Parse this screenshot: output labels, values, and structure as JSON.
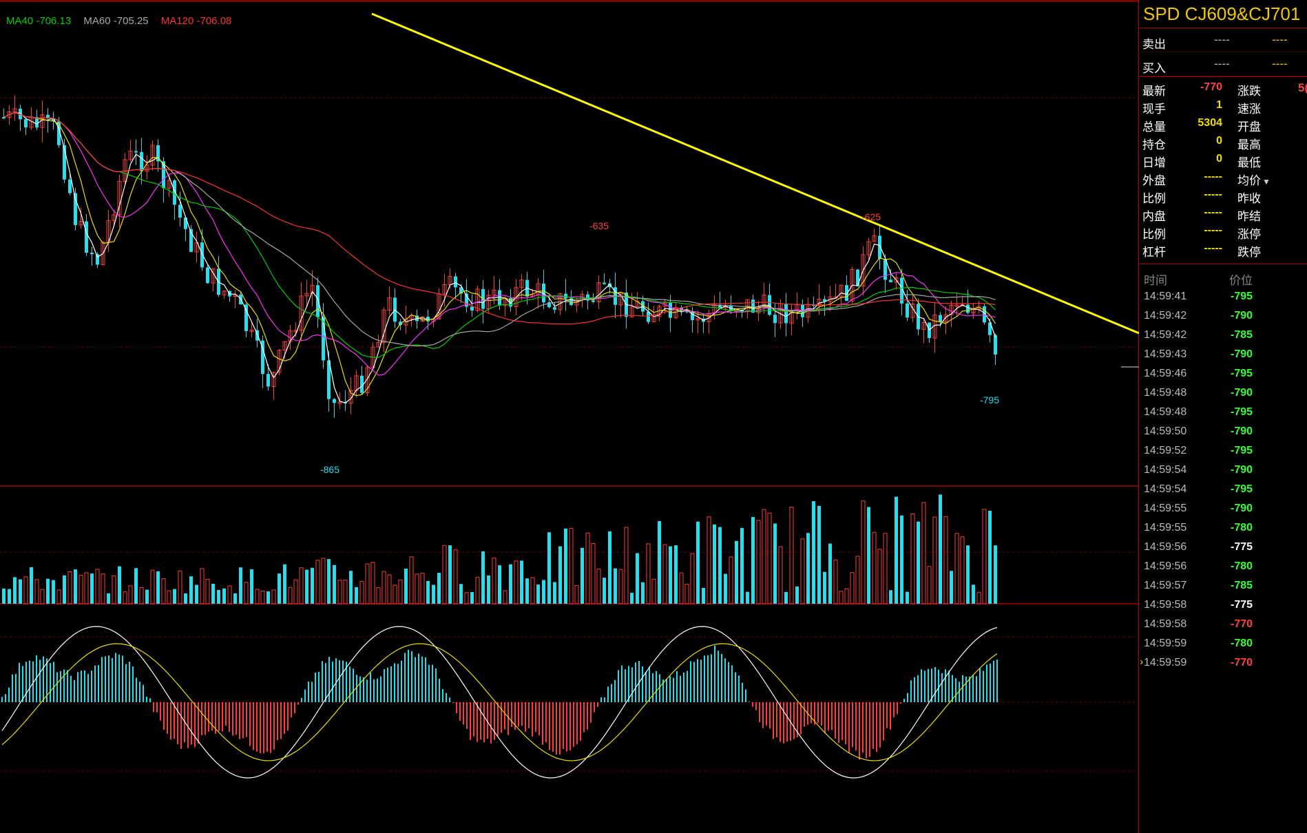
{
  "indicators": [
    {
      "label": "MA40 -706.13",
      "color": "#00d000"
    },
    {
      "label": "MA60 -705.25",
      "color": "#a8a8a8"
    },
    {
      "label": "MA120 -706.08",
      "color": "#ff3030"
    }
  ],
  "price_annotations": {
    "high_1": "-635",
    "high_2": "-625",
    "low_1": "-865",
    "last": "-795"
  },
  "quote_panel": {
    "title": "SPD CJ609&CJ701",
    "order_book": [
      {
        "label": "卖出",
        "v1": "----",
        "v2": "----"
      },
      {
        "label": "买入",
        "v1": "----",
        "v2": "----"
      }
    ],
    "rows": [
      {
        "l": "最新",
        "v": "-770",
        "vc": "#ff4040",
        "r": "涨跌",
        "rv": "5("
      },
      {
        "l": "现手",
        "v": "1",
        "vc": "#f0e000",
        "r": "速涨",
        "rv": ""
      },
      {
        "l": "总量",
        "v": "5304",
        "vc": "#f0e000",
        "r": "开盘",
        "rv": ""
      },
      {
        "l": "持仓",
        "v": "0",
        "vc": "#f0e000",
        "r": "最高",
        "rv": ""
      },
      {
        "l": "日增",
        "v": "0",
        "vc": "#f0e000",
        "r": "最低",
        "rv": ""
      },
      {
        "l": "外盘",
        "v": "-----",
        "vc": "#f0e000",
        "r": "均价",
        "rv": ""
      },
      {
        "l": "比例",
        "v": "-----",
        "vc": "#f0e000",
        "r": "昨收",
        "rv": ""
      },
      {
        "l": "内盘",
        "v": "-----",
        "vc": "#f0e000",
        "r": "昨结",
        "rv": ""
      },
      {
        "l": "比例",
        "v": "-----",
        "vc": "#f0e000",
        "r": "涨停",
        "rv": ""
      },
      {
        "l": "杠杆",
        "v": "-----",
        "vc": "#f0e000",
        "r": "跌停",
        "rv": ""
      }
    ],
    "ticks_header": {
      "time": "时间",
      "price": "价位"
    },
    "ticks": [
      {
        "t": "14:59:41",
        "p": "-795",
        "c": "#33ff33"
      },
      {
        "t": "14:59:42",
        "p": "-790",
        "c": "#33ff33"
      },
      {
        "t": "14:59:42",
        "p": "-785",
        "c": "#33ff33"
      },
      {
        "t": "14:59:43",
        "p": "-790",
        "c": "#33ff33"
      },
      {
        "t": "14:59:46",
        "p": "-795",
        "c": "#33ff33"
      },
      {
        "t": "14:59:48",
        "p": "-790",
        "c": "#33ff33"
      },
      {
        "t": "14:59:48",
        "p": "-795",
        "c": "#33ff33"
      },
      {
        "t": "14:59:50",
        "p": "-790",
        "c": "#33ff33"
      },
      {
        "t": "14:59:52",
        "p": "-795",
        "c": "#33ff33"
      },
      {
        "t": "14:59:54",
        "p": "-790",
        "c": "#33ff33"
      },
      {
        "t": "14:59:54",
        "p": "-795",
        "c": "#33ff33"
      },
      {
        "t": "14:59:55",
        "p": "-790",
        "c": "#33ff33"
      },
      {
        "t": "14:59:55",
        "p": "-780",
        "c": "#33ff33"
      },
      {
        "t": "14:59:56",
        "p": "-775",
        "c": "#ffffff"
      },
      {
        "t": "14:59:56",
        "p": "-780",
        "c": "#33ff33"
      },
      {
        "t": "14:59:57",
        "p": "-785",
        "c": "#33ff33"
      },
      {
        "t": "14:59:58",
        "p": "-775",
        "c": "#ffffff"
      },
      {
        "t": "14:59:58",
        "p": "-770",
        "c": "#ff4040"
      },
      {
        "t": "14:59:59",
        "p": "-780",
        "c": "#33ff33"
      },
      {
        "t": "14:59:59",
        "p": "-770",
        "c": "#ff4040",
        "current": true
      }
    ],
    "cursor_mark": "›"
  },
  "colors": {
    "up": "#ff3c3c",
    "down": "#22e0ee",
    "trend": "#ffff00",
    "divider": "#b00000"
  }
}
